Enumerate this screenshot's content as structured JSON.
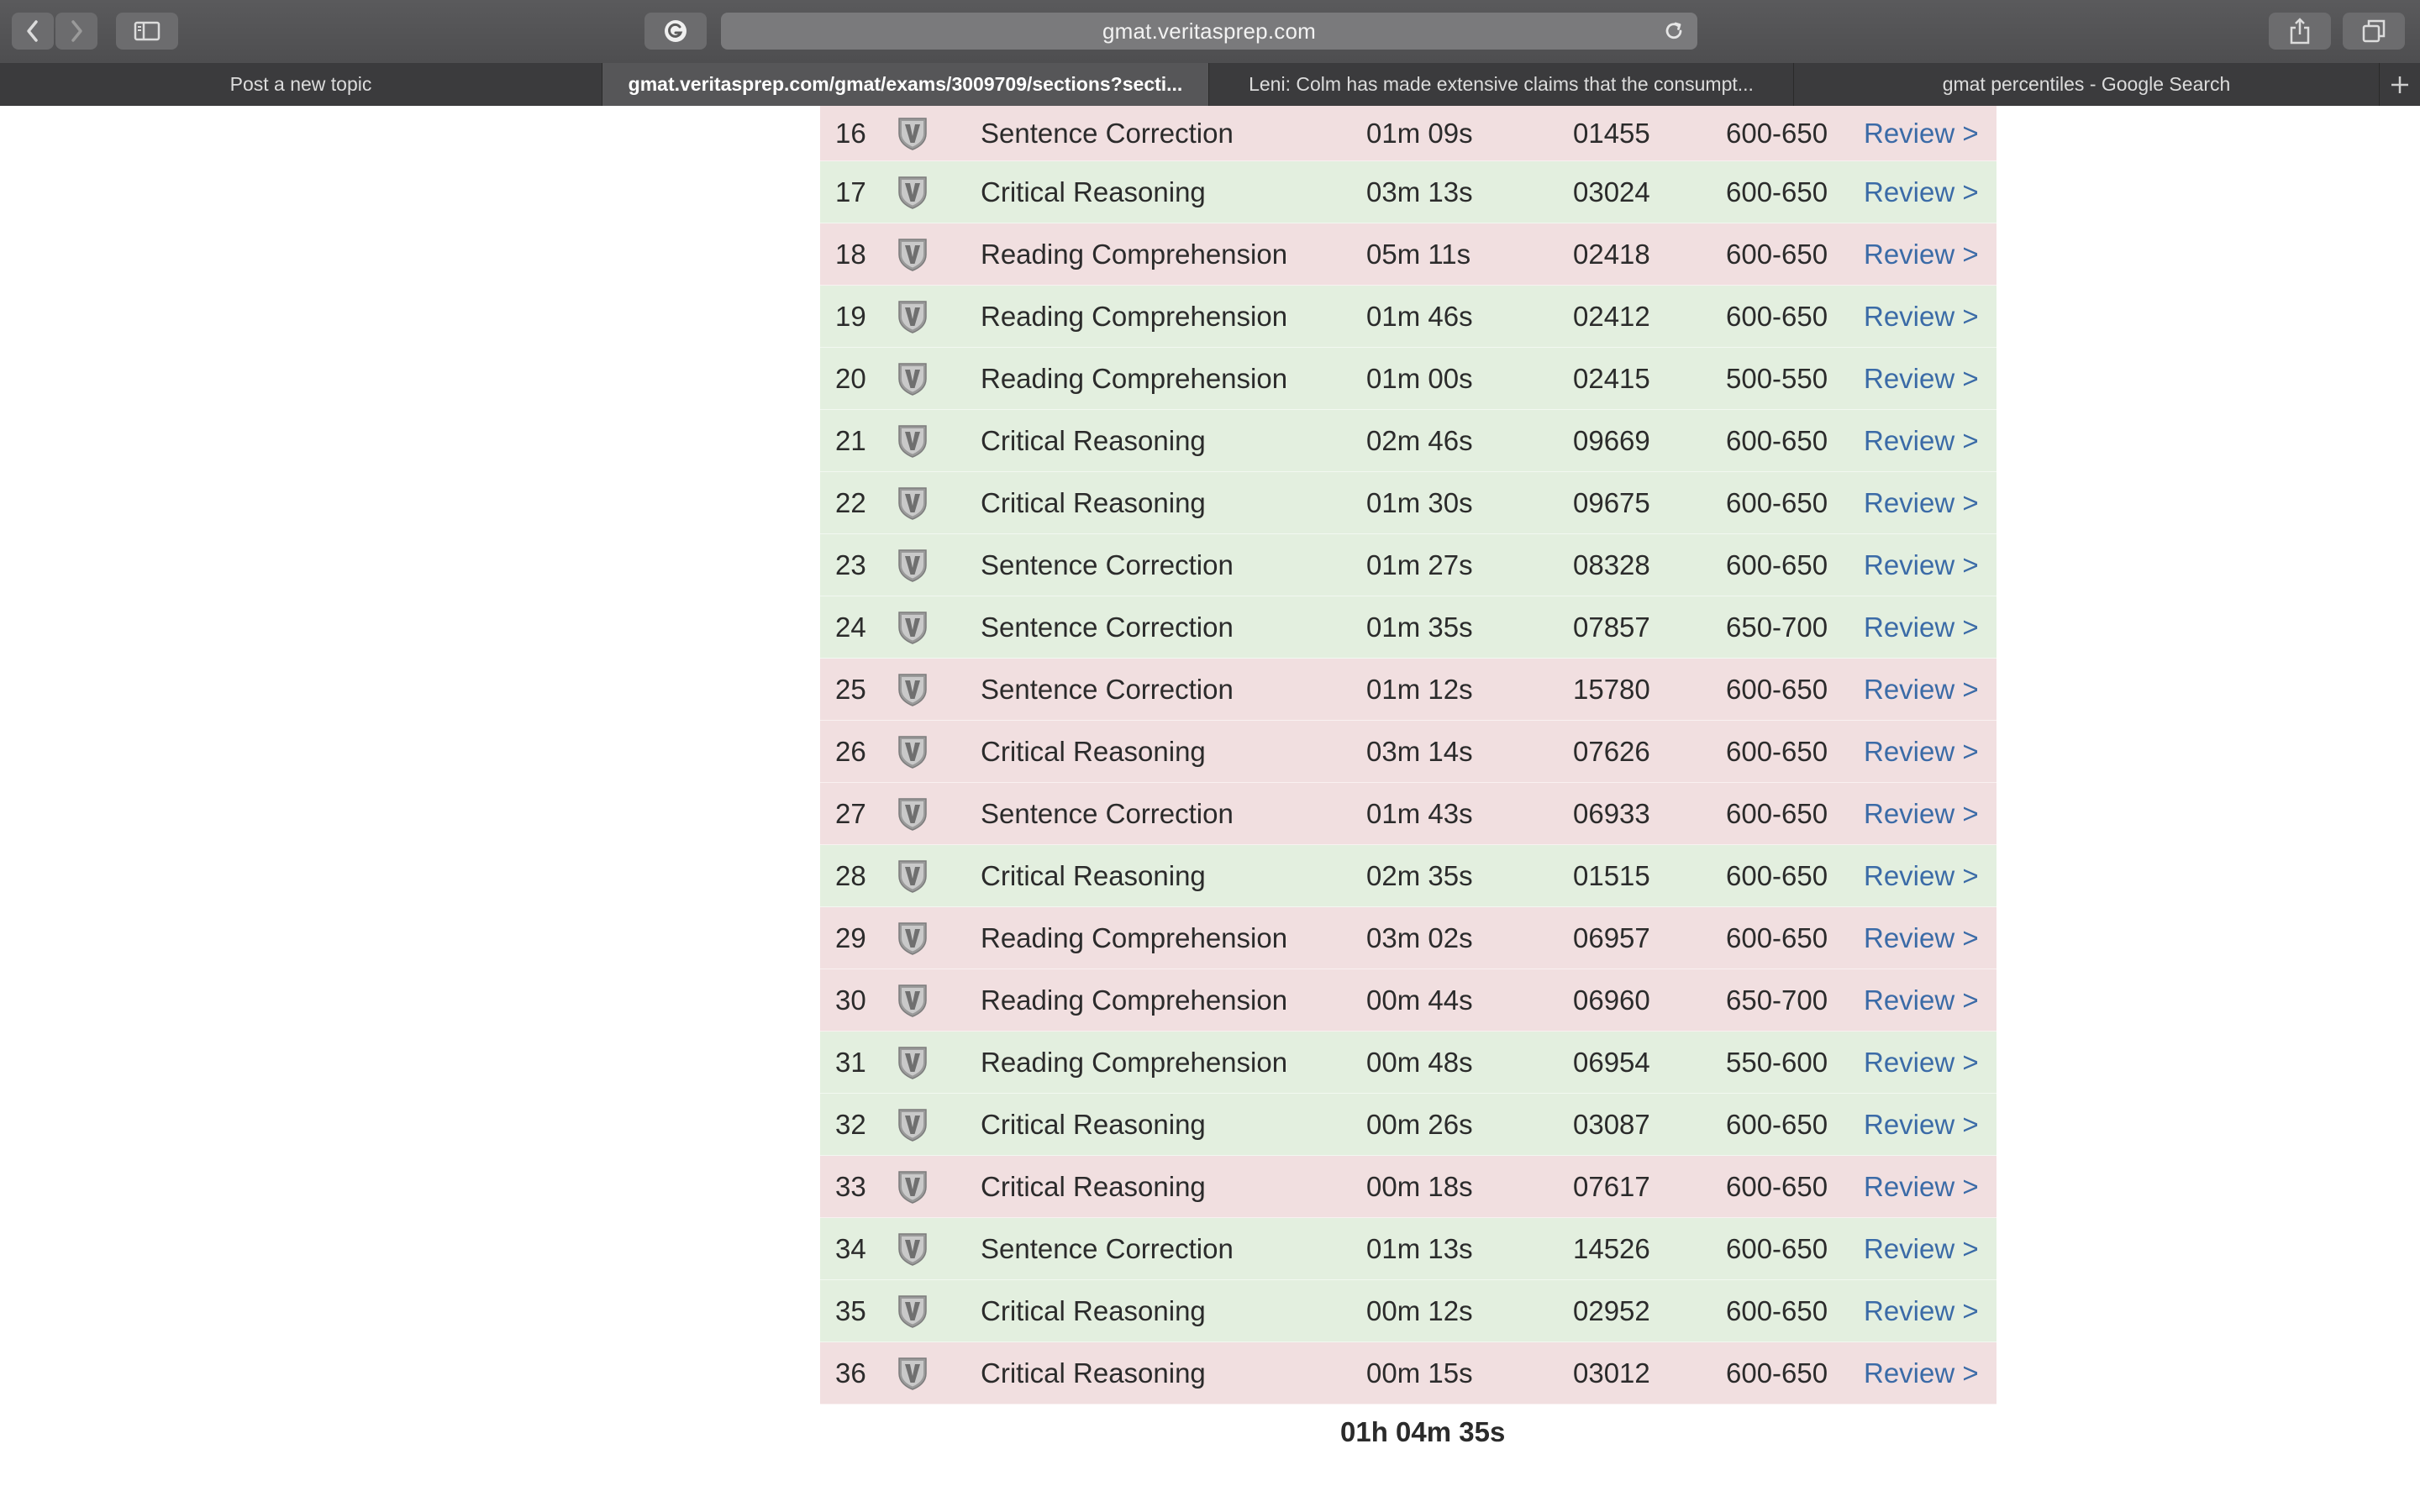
{
  "browser": {
    "address": "gmat.veritasprep.com",
    "tabs": [
      {
        "label": "Post a new topic",
        "active": false
      },
      {
        "label": "gmat.veritasprep.com/gmat/exams/3009709/sections?secti...",
        "active": true
      },
      {
        "label": "Leni: Colm has made extensive claims that the consumpt...",
        "active": false
      },
      {
        "label": "gmat percentiles - Google Search",
        "active": false
      }
    ]
  },
  "results": {
    "review_label": "Review >",
    "rows": [
      {
        "num": "16",
        "type": "Sentence Correction",
        "time": "01m 09s",
        "id": "01455",
        "range": "600-650",
        "status": "incorrect"
      },
      {
        "num": "17",
        "type": "Critical Reasoning",
        "time": "03m 13s",
        "id": "03024",
        "range": "600-650",
        "status": "correct"
      },
      {
        "num": "18",
        "type": "Reading Comprehension",
        "time": "05m 11s",
        "id": "02418",
        "range": "600-650",
        "status": "incorrect"
      },
      {
        "num": "19",
        "type": "Reading Comprehension",
        "time": "01m 46s",
        "id": "02412",
        "range": "600-650",
        "status": "correct"
      },
      {
        "num": "20",
        "type": "Reading Comprehension",
        "time": "01m 00s",
        "id": "02415",
        "range": "500-550",
        "status": "correct"
      },
      {
        "num": "21",
        "type": "Critical Reasoning",
        "time": "02m 46s",
        "id": "09669",
        "range": "600-650",
        "status": "correct"
      },
      {
        "num": "22",
        "type": "Critical Reasoning",
        "time": "01m 30s",
        "id": "09675",
        "range": "600-650",
        "status": "correct"
      },
      {
        "num": "23",
        "type": "Sentence Correction",
        "time": "01m 27s",
        "id": "08328",
        "range": "600-650",
        "status": "correct"
      },
      {
        "num": "24",
        "type": "Sentence Correction",
        "time": "01m 35s",
        "id": "07857",
        "range": "650-700",
        "status": "correct"
      },
      {
        "num": "25",
        "type": "Sentence Correction",
        "time": "01m 12s",
        "id": "15780",
        "range": "600-650",
        "status": "incorrect"
      },
      {
        "num": "26",
        "type": "Critical Reasoning",
        "time": "03m 14s",
        "id": "07626",
        "range": "600-650",
        "status": "incorrect"
      },
      {
        "num": "27",
        "type": "Sentence Correction",
        "time": "01m 43s",
        "id": "06933",
        "range": "600-650",
        "status": "incorrect"
      },
      {
        "num": "28",
        "type": "Critical Reasoning",
        "time": "02m 35s",
        "id": "01515",
        "range": "600-650",
        "status": "correct"
      },
      {
        "num": "29",
        "type": "Reading Comprehension",
        "time": "03m 02s",
        "id": "06957",
        "range": "600-650",
        "status": "incorrect"
      },
      {
        "num": "30",
        "type": "Reading Comprehension",
        "time": "00m 44s",
        "id": "06960",
        "range": "650-700",
        "status": "incorrect"
      },
      {
        "num": "31",
        "type": "Reading Comprehension",
        "time": "00m 48s",
        "id": "06954",
        "range": "550-600",
        "status": "correct"
      },
      {
        "num": "32",
        "type": "Critical Reasoning",
        "time": "00m 26s",
        "id": "03087",
        "range": "600-650",
        "status": "correct"
      },
      {
        "num": "33",
        "type": "Critical Reasoning",
        "time": "00m 18s",
        "id": "07617",
        "range": "600-650",
        "status": "incorrect"
      },
      {
        "num": "34",
        "type": "Sentence Correction",
        "time": "01m 13s",
        "id": "14526",
        "range": "600-650",
        "status": "correct"
      },
      {
        "num": "35",
        "type": "Critical Reasoning",
        "time": "00m 12s",
        "id": "02952",
        "range": "600-650",
        "status": "correct"
      },
      {
        "num": "36",
        "type": "Critical Reasoning",
        "time": "00m 15s",
        "id": "03012",
        "range": "600-650",
        "status": "incorrect"
      }
    ],
    "total_time": "01h 04m 35s"
  },
  "colors": {
    "incorrect_row": "#f1dfe0",
    "correct_row": "#e3efdf",
    "review_link": "#3b6ba7"
  },
  "icons": {
    "row_icon": "veritas-shield-icon"
  }
}
